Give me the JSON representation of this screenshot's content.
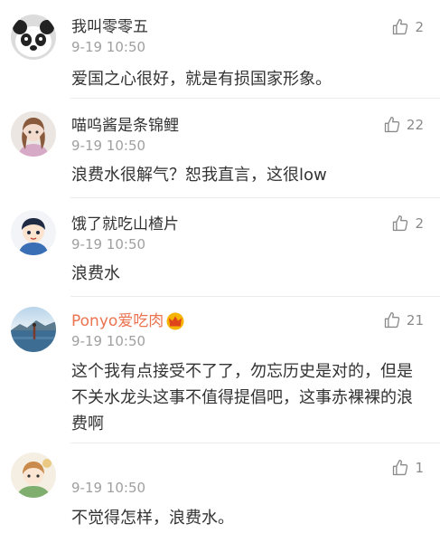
{
  "comments": [
    {
      "username": "我叫零零五",
      "time": "9-19 10:50",
      "text": "爱国之心很好，就是有损国家形象。",
      "likes": "2",
      "avatar_icon": "panda-avatar-icon"
    },
    {
      "username": "喵呜酱是条锦鲤",
      "time": "9-19 10:50",
      "text": "浪费水很解气？恕我直言，这很low",
      "likes": "22",
      "avatar_icon": "doll-avatar-icon"
    },
    {
      "username": "饿了就吃山楂片",
      "time": "9-19 10:50",
      "text": "浪费水",
      "likes": "2",
      "avatar_icon": "cartoon-boy-avatar-icon"
    },
    {
      "username": "Ponyo爱吃肉",
      "time": "9-19 10:50",
      "text": "这个我有点接受不了了，勿忘历史是对的，但是不关水龙头这事不值得提倡吧，这事赤裸裸的浪费啊",
      "likes": "21",
      "avatar_icon": "lake-photo-avatar-icon",
      "badge_icon": "vip-crown-icon"
    },
    {
      "username": "",
      "time": "9-19 10:50",
      "text": "不觉得怎样，浪费水。",
      "likes": "1",
      "avatar_icon": "anime-avatar-icon"
    }
  ],
  "colors": {
    "vip_name": "#eb7350",
    "crown_gold": "#f4b400",
    "meta_gray": "#a0a0a0",
    "text": "#333333"
  }
}
